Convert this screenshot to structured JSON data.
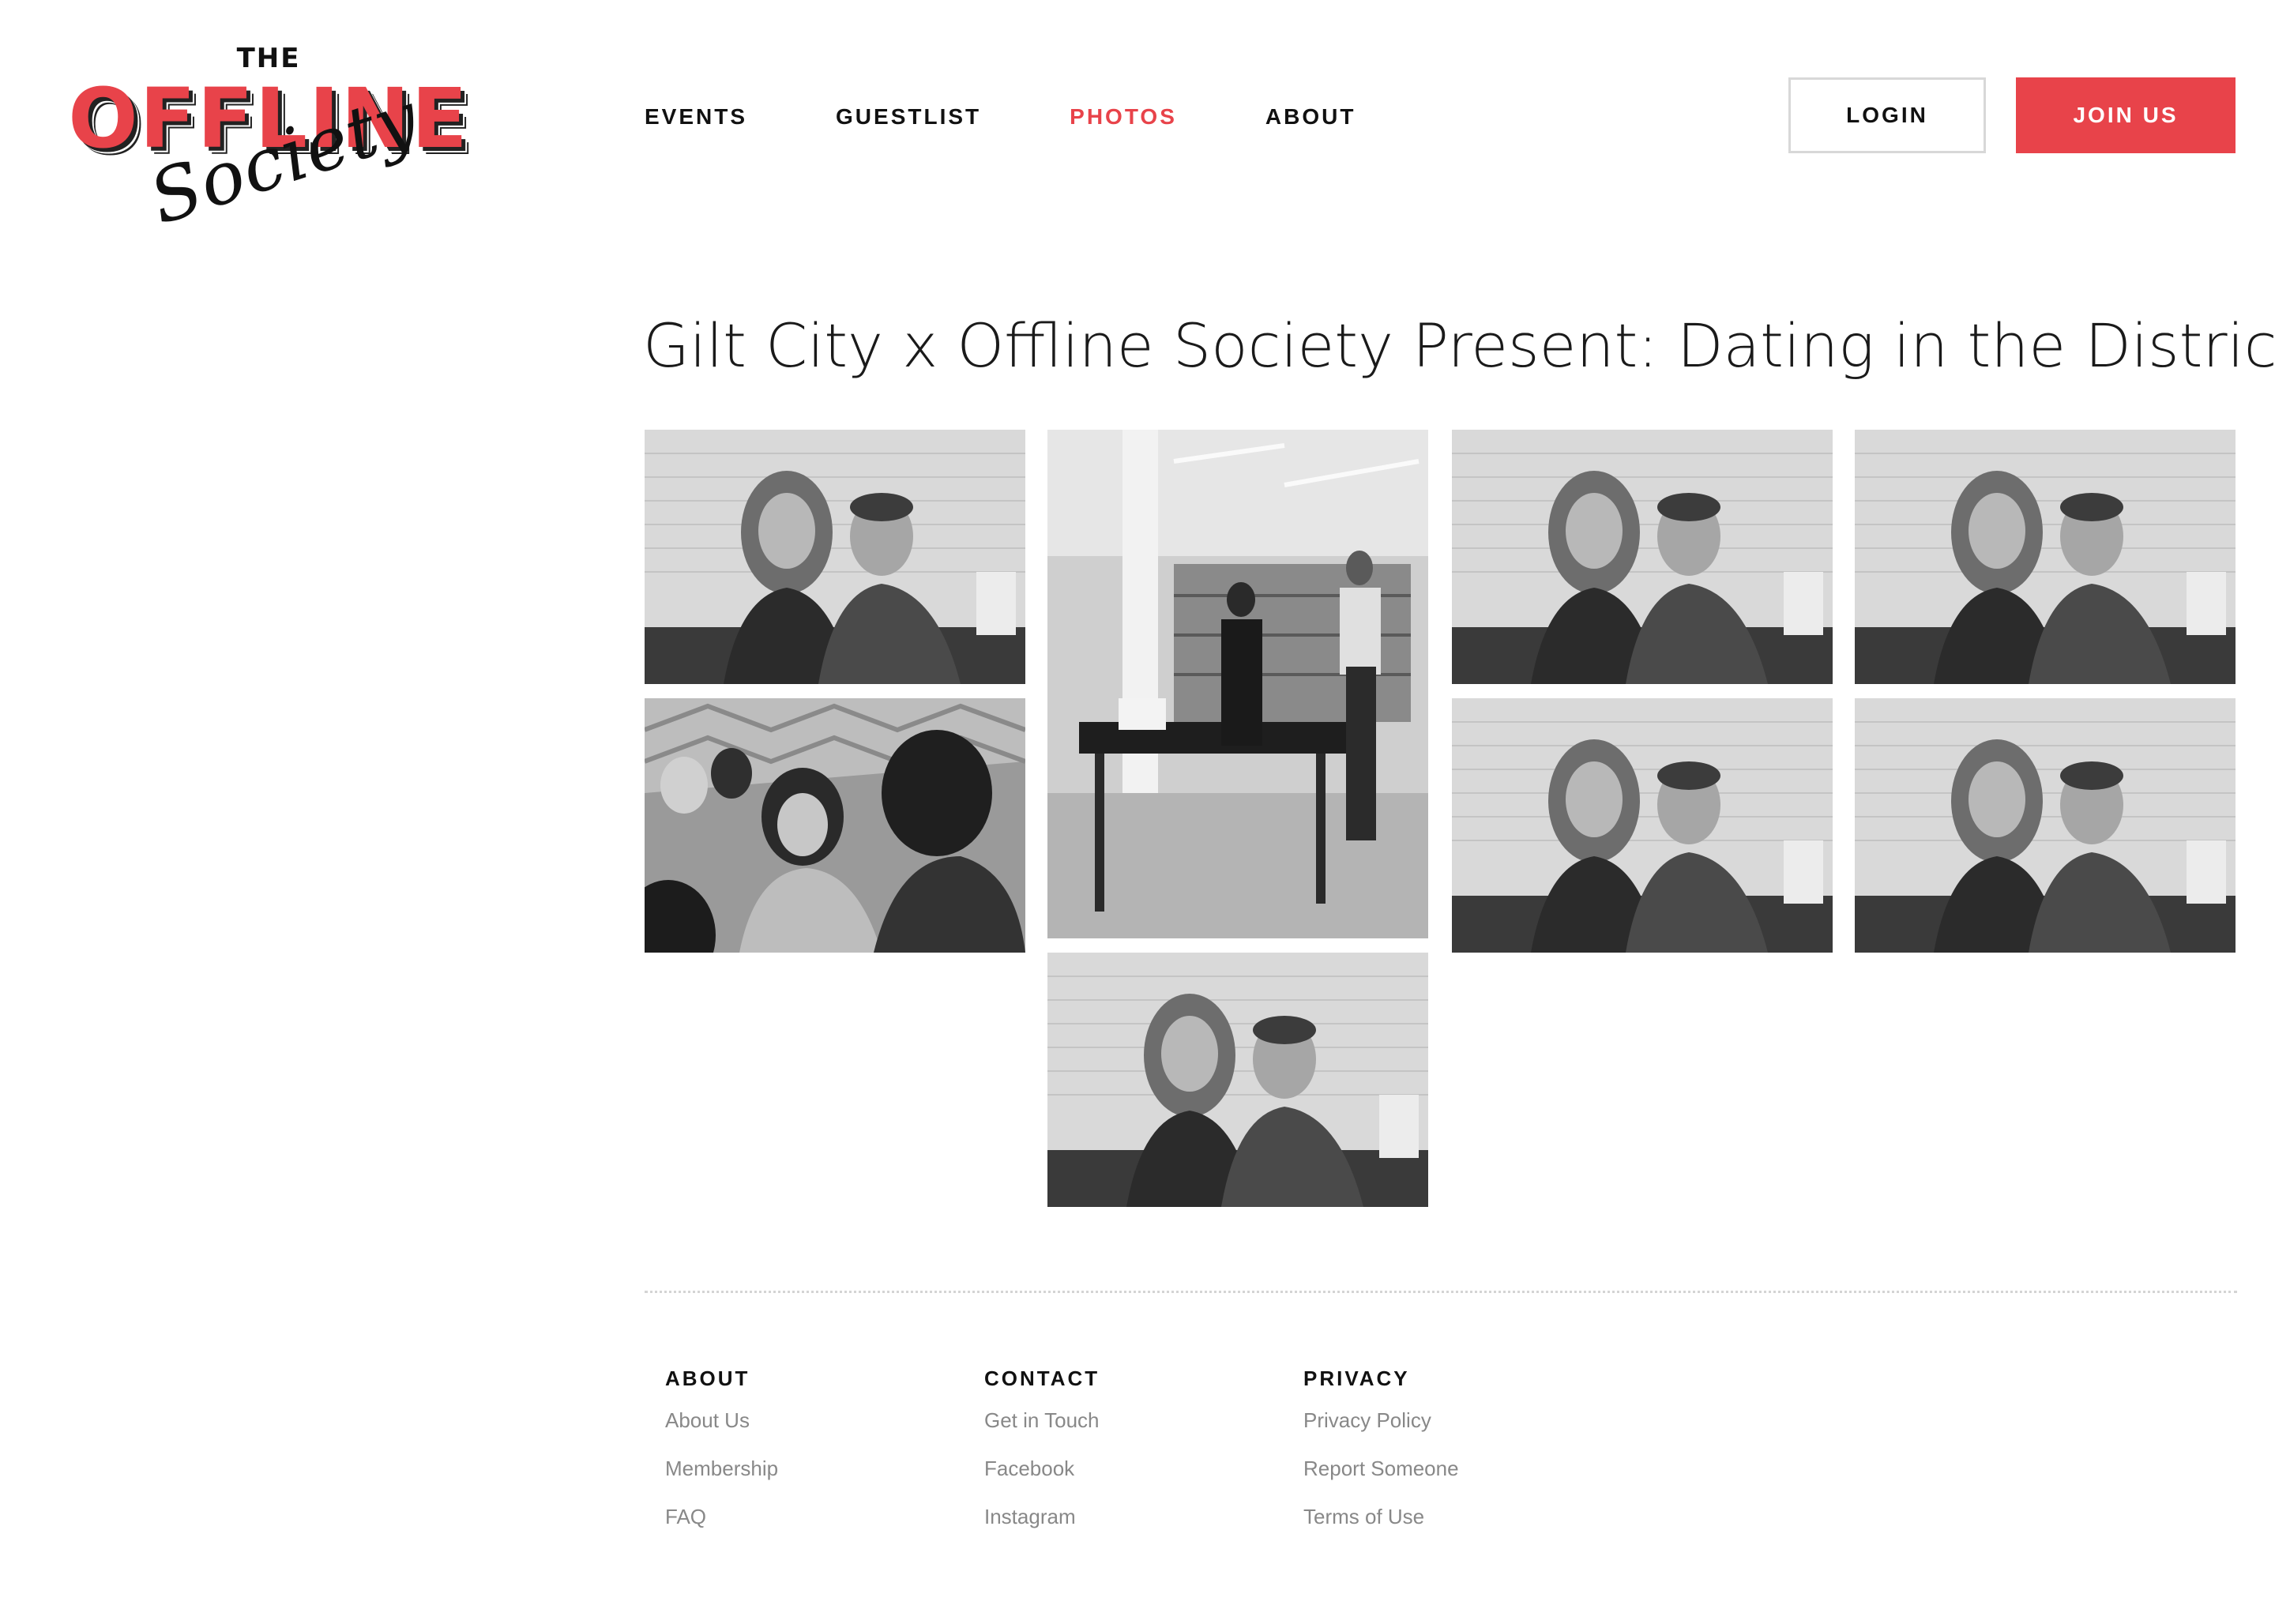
{
  "brand": {
    "the": "THE",
    "offline": "OFFLINE",
    "society": "Society",
    "accent_color": "#e8434a"
  },
  "nav": {
    "items": [
      {
        "label": "EVENTS",
        "active": false
      },
      {
        "label": "GUESTLIST",
        "active": false
      },
      {
        "label": "PHOTOS",
        "active": true
      },
      {
        "label": "ABOUT",
        "active": false
      }
    ],
    "login_label": "LOGIN",
    "join_label": "JOIN US"
  },
  "main": {
    "title": "Gilt City x Offline Society Present: Dating in the District",
    "photos": [
      {
        "scene": "couple-portrait"
      },
      {
        "scene": "venue-interior"
      },
      {
        "scene": "couple-portrait"
      },
      {
        "scene": "couple-portrait"
      },
      {
        "scene": "crowd-conversation"
      },
      {
        "scene": "couple-portrait"
      },
      {
        "scene": "couple-portrait"
      },
      {
        "scene": "couple-portrait"
      }
    ]
  },
  "footer": {
    "columns": [
      {
        "heading": "ABOUT",
        "links": [
          "About Us",
          "Membership",
          "FAQ"
        ]
      },
      {
        "heading": "CONTACT",
        "links": [
          "Get in Touch",
          "Facebook",
          "Instagram"
        ]
      },
      {
        "heading": "PRIVACY",
        "links": [
          "Privacy Policy",
          "Report Someone",
          "Terms of Use"
        ]
      }
    ]
  }
}
